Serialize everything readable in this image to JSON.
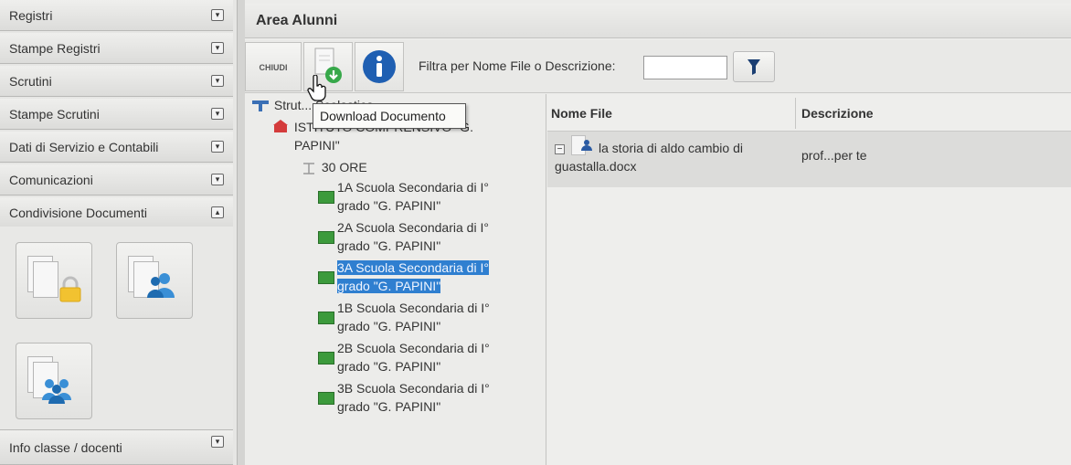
{
  "sidebar": {
    "items": [
      {
        "label": "Registri"
      },
      {
        "label": "Stampe Registri"
      },
      {
        "label": "Scrutini"
      },
      {
        "label": "Stampe Scrutini"
      },
      {
        "label": "Dati di Servizio e Contabili"
      },
      {
        "label": "Comunicazioni"
      },
      {
        "label": "Condivisione Documenti"
      }
    ],
    "footer_label": "Info classe / docenti"
  },
  "main": {
    "title": "Area Alunni",
    "toolbar": {
      "close_label": "CHIUDI",
      "filter_label": "Filtra per Nome File o Descrizione:",
      "filter_value": ""
    },
    "tooltip": "Download Documento",
    "tree": {
      "root_label": "Strut... Scolastica",
      "school_label_line1": "ISTITUTO COMPRENSIVO \"G.",
      "school_label_line2": "PAPINI\"",
      "group_label": "30 ORE",
      "classes": [
        {
          "line1": "1A Scuola Secondaria di I°",
          "line2": "grado \"G. PAPINI\""
        },
        {
          "line1": "2A Scuola Secondaria di I°",
          "line2": "grado \"G. PAPINI\""
        },
        {
          "line1": "3A Scuola Secondaria di I°",
          "line2": "grado \"G. PAPINI\""
        },
        {
          "line1": "1B Scuola Secondaria di I°",
          "line2": "grado \"G. PAPINI\""
        },
        {
          "line1": "2B Scuola Secondaria di I°",
          "line2": "grado \"G. PAPINI\""
        },
        {
          "line1": "3B Scuola Secondaria di I°",
          "line2": "grado \"G. PAPINI\""
        }
      ],
      "selected_class": "3A"
    },
    "grid": {
      "columns": [
        "Nome File",
        "Descrizione"
      ],
      "rows": [
        {
          "file_line1": "la storia di aldo cambio di",
          "file_line2": "guastalla.docx",
          "description": "prof...per te"
        }
      ]
    }
  },
  "colors": {
    "selection": "#2f7fd0",
    "info_blue": "#1f5fb2",
    "download_green": "#37a84a",
    "lock_yellow": "#f2c230",
    "people_blue": "#3a8fd6",
    "tree_green": "#3c9a3c"
  }
}
